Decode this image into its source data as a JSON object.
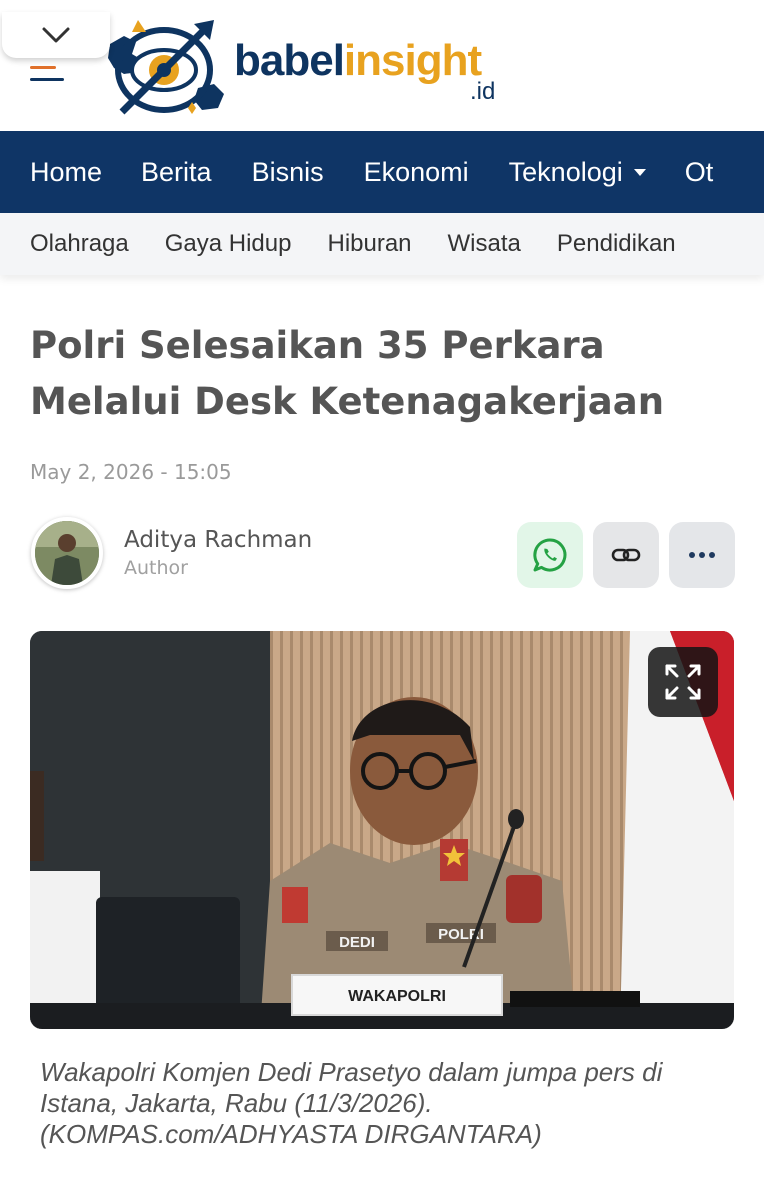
{
  "brand": {
    "name_part1": "babel",
    "name_part2": "insight",
    "suffix": ".id",
    "color_primary": "#0f3566",
    "color_accent": "#e8a21f"
  },
  "header": {
    "collapse_icon": "chevron-down-icon",
    "menu_icon": "hamburger-icon"
  },
  "nav_primary": [
    {
      "label": "Home"
    },
    {
      "label": "Berita"
    },
    {
      "label": "Bisnis"
    },
    {
      "label": "Ekonomi"
    },
    {
      "label": "Teknologi",
      "has_dropdown": true
    },
    {
      "label": "Ot"
    }
  ],
  "nav_secondary": [
    {
      "label": "Olahraga"
    },
    {
      "label": "Gaya Hidup"
    },
    {
      "label": "Hiburan"
    },
    {
      "label": "Wisata"
    },
    {
      "label": "Pendidikan"
    }
  ],
  "article": {
    "title": "Polri Selesaikan 35 Perkara Melalui Desk Ketenagakerjaan",
    "date": "May 2, 2026 - 15:05",
    "author": {
      "name": "Aditya Rachman",
      "role": "Author"
    },
    "share_buttons": [
      {
        "icon": "whatsapp-icon",
        "color": "#25a244"
      },
      {
        "icon": "link-icon",
        "color": "#222222"
      },
      {
        "icon": "more-icon",
        "color": "#1f3a5f"
      }
    ],
    "photo": {
      "nameplate": "WAKAPOLRI",
      "badge_name": "DEDI",
      "badge_org": "POLRI",
      "expand_icon": "expand-icon"
    },
    "caption": "Wakapolri Komjen Dedi Prasetyo dalam jumpa pers di Istana, Jakarta, Rabu (11/3/2026). (KOMPAS.com/ADHYASTA DIRGANTARA)"
  }
}
